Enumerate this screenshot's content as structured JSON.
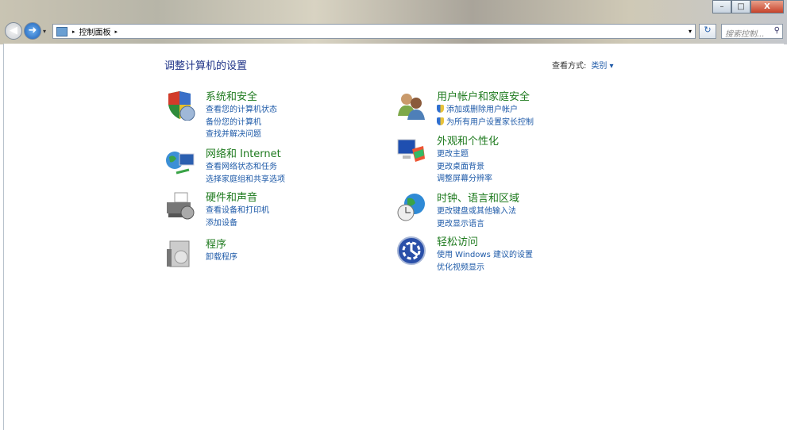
{
  "window": {
    "minimize": "–",
    "maximize": "□",
    "close": "X"
  },
  "address": {
    "breadcrumb": "控制面板",
    "sep": "▸",
    "dropdown": "▾"
  },
  "search": {
    "placeholder": "搜索控制...",
    "icon": "search-icon"
  },
  "heading": "调整计算机的设置",
  "view": {
    "label": "查看方式:",
    "value": "类别 ▾"
  },
  "left": [
    {
      "title": "系统和安全",
      "icon": "shield-icon",
      "links": [
        "查看您的计算机状态",
        "备份您的计算机",
        "查找并解决问题"
      ]
    },
    {
      "title": "网络和 Internet",
      "icon": "network-icon",
      "links": [
        "查看网络状态和任务",
        "选择家庭组和共享选项"
      ]
    },
    {
      "title": "硬件和声音",
      "icon": "printer-icon",
      "links": [
        "查看设备和打印机",
        "添加设备"
      ]
    },
    {
      "title": "程序",
      "icon": "programs-icon",
      "links": [
        "卸载程序"
      ]
    }
  ],
  "right": [
    {
      "title": "用户帐户和家庭安全",
      "icon": "users-icon",
      "links": [
        "添加或删除用户帐户",
        "为所有用户设置家长控制"
      ]
    },
    {
      "title": "外观和个性化",
      "icon": "appearance-icon",
      "links": [
        "更改主题",
        "更改桌面背景",
        "调整屏幕分辨率"
      ]
    },
    {
      "title": "时钟、语言和区域",
      "icon": "clock-globe-icon",
      "links": [
        "更改键盘或其他输入法",
        "更改显示语言"
      ]
    },
    {
      "title": "轻松访问",
      "icon": "ease-of-access-icon",
      "links": [
        "使用 Windows 建议的设置",
        "优化视频显示"
      ]
    }
  ]
}
